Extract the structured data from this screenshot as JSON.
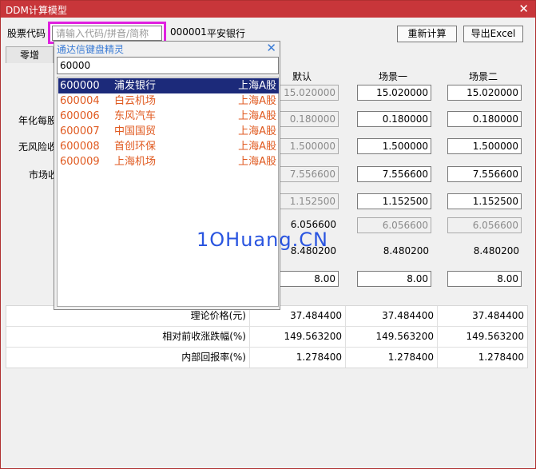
{
  "window": {
    "title": "DDM计算模型",
    "close": "✕"
  },
  "stock": {
    "label": "股票代码",
    "placeholder": "请输入代码/拼音/简称",
    "code": "000001",
    "name": "平安银行"
  },
  "buttons": {
    "recalc": "重新计算",
    "export": "导出Excel"
  },
  "tab": {
    "label": "零增"
  },
  "columns": [
    "默认",
    "场景一",
    "场景二"
  ],
  "row_labels": {
    "annual_div": "年化每股",
    "riskfree": "无风险收",
    "market": "市场收"
  },
  "grid": [
    [
      "15.020000",
      "15.020000",
      "15.020000"
    ],
    [
      "0.180000",
      "0.180000",
      "0.180000"
    ],
    [
      "1.500000",
      "1.500000",
      "1.500000"
    ],
    [
      "7.556600",
      "7.556600",
      "7.556600"
    ],
    [
      "1.152500",
      "1.152500",
      "1.152500"
    ],
    [
      "6.056600",
      "6.056600",
      "6.056600"
    ],
    [
      "8.480200",
      "8.480200",
      "8.480200"
    ],
    [
      "8.00",
      "8.00",
      "8.00"
    ]
  ],
  "results": [
    {
      "label": "理论价格(元)",
      "values": [
        "37.484400",
        "37.484400",
        "37.484400"
      ]
    },
    {
      "label": "相对前收涨跌幅(%)",
      "values": [
        "149.563200",
        "149.563200",
        "149.563200"
      ]
    },
    {
      "label": "内部回报率(%)",
      "values": [
        "1.278400",
        "1.278400",
        "1.278400"
      ]
    }
  ],
  "popup": {
    "title": "通达信键盘精灵",
    "close": "✕",
    "query": "60000",
    "items": [
      {
        "code": "600000",
        "name": "浦发银行",
        "market": "上海A股"
      },
      {
        "code": "600004",
        "name": "白云机场",
        "market": "上海A股"
      },
      {
        "code": "600006",
        "name": "东风汽车",
        "market": "上海A股"
      },
      {
        "code": "600007",
        "name": "中国国贸",
        "market": "上海A股"
      },
      {
        "code": "600008",
        "name": "首创环保",
        "market": "上海A股"
      },
      {
        "code": "600009",
        "name": "上海机场",
        "market": "上海A股"
      }
    ]
  },
  "watermark": "1OHuang.CN"
}
